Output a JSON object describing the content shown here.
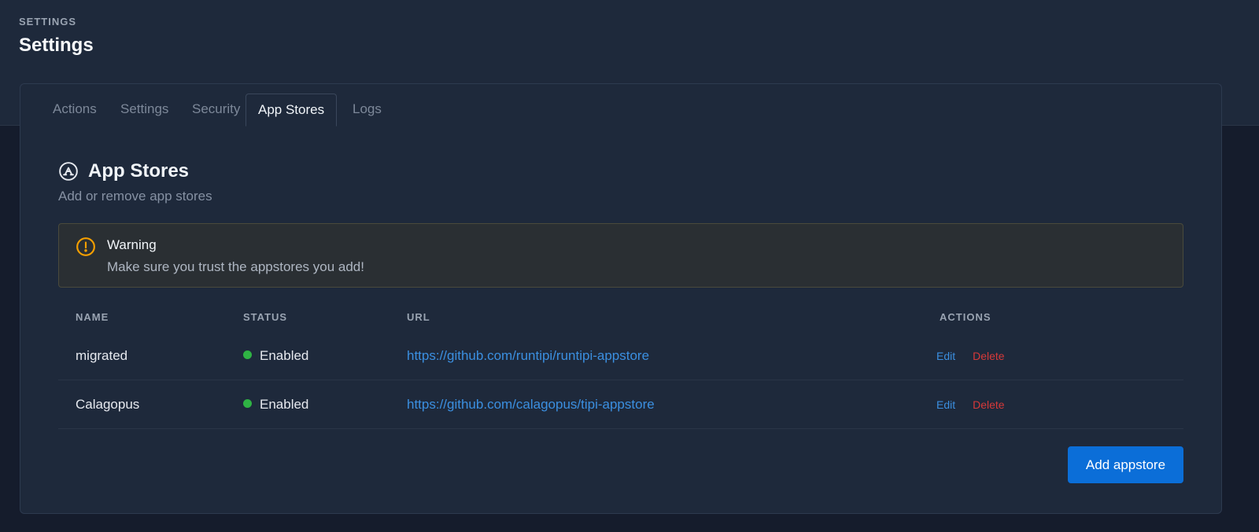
{
  "header": {
    "pretitle": "SETTINGS",
    "title": "Settings"
  },
  "tabs": [
    {
      "label": "Actions",
      "active": false
    },
    {
      "label": "Settings",
      "active": false
    },
    {
      "label": "Security",
      "active": false
    },
    {
      "label": "App Stores",
      "active": true
    },
    {
      "label": "Logs",
      "active": false
    }
  ],
  "section": {
    "icon": "app-store-icon",
    "title": "App Stores",
    "subtitle": "Add or remove app stores"
  },
  "warning": {
    "icon": "alert-circle-icon",
    "title": "Warning",
    "message": "Make sure you trust the appstores you add!"
  },
  "table": {
    "columns": [
      "NAME",
      "STATUS",
      "URL",
      "ACTIONS"
    ],
    "rows": [
      {
        "name": "migrated",
        "status": "Enabled",
        "url": "https://github.com/runtipi/runtipi-appstore",
        "edit_label": "Edit",
        "delete_label": "Delete"
      },
      {
        "name": "Calagopus",
        "status": "Enabled",
        "url": "https://github.com/calagopus/tipi-appstore",
        "edit_label": "Edit",
        "delete_label": "Delete"
      }
    ]
  },
  "add_button_label": "Add appstore",
  "colors": {
    "accent": "#0b6ed8",
    "status_enabled": "#2fb344",
    "warning": "#f59f00",
    "danger": "#d63939"
  }
}
